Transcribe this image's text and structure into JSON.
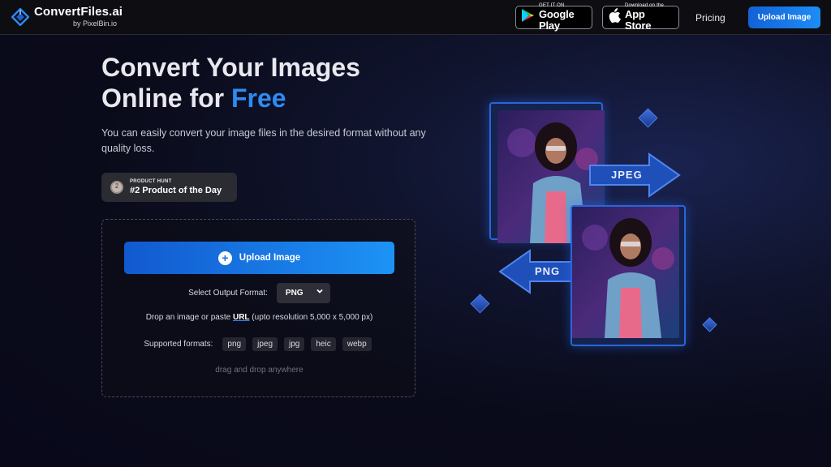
{
  "header": {
    "logo_title": "ConvertFiles.ai",
    "logo_sub": "by PixelBin.io",
    "google_play": {
      "small": "GET IT ON",
      "big": "Google Play"
    },
    "app_store": {
      "small": "Download on the",
      "big": "App Store"
    },
    "pricing": "Pricing",
    "upload_button": "Upload Image"
  },
  "hero": {
    "title_line1": "Convert Your Images",
    "title_line2_prefix": "Online for ",
    "title_line2_accent": "Free",
    "description": "You can easily convert your image files in the desired format without any quality loss."
  },
  "product_hunt": {
    "label": "PRODUCT HUNT",
    "title": "#2 Product of the Day",
    "medal_number": "2"
  },
  "uploader": {
    "button_label": "Upload Image",
    "output_format_label": "Select Output Format:",
    "selected_format": "PNG",
    "paste_prefix": "Drop an image or paste ",
    "paste_url": "URL",
    "paste_suffix": " (upto resolution 5,000 x 5,000 px)",
    "supported_label": "Supported formats:",
    "formats": [
      "png",
      "jpeg",
      "jpg",
      "heic",
      "webp"
    ],
    "drag_drop": "drag and drop anywhere"
  },
  "illustration": {
    "arrow_right_label": "JPEG",
    "arrow_left_label": "PNG"
  },
  "colors": {
    "accent": "#2e8bf2",
    "button_gradient_start": "#1259cf",
    "button_gradient_end": "#1d93f5"
  }
}
